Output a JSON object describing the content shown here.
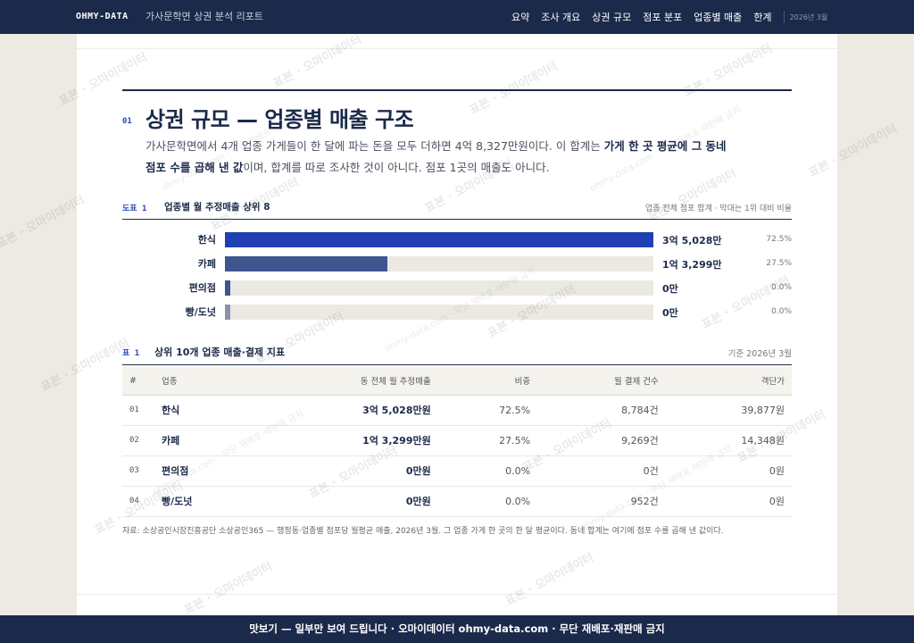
{
  "header": {
    "brand": "OHMY-DATA",
    "report_title": "가사문학면 상권 분석 리포트",
    "nav": [
      "요약",
      "조사 개요",
      "상권 규모",
      "점포 분포",
      "업종별 매출",
      "한계"
    ],
    "date": "2026년 3월"
  },
  "section": {
    "number": "01",
    "title": "상권 규모 — 업종별 매출 구조",
    "lead_part1": "가사문학면에서 4개 업종 가게들이 한 달에 파는 돈을 모두 더하면 4억 8,327만원이다. 이 합계는 ",
    "lead_bold": "가게 한 곳 평균에 그 동네 점포 수를 곱해 낸 값",
    "lead_part2": "이며, 합계를 따로 조사한 것이 아니다. 점포 1곳의 매출도 아니다."
  },
  "figure": {
    "tag": "도표 1",
    "title": "업종별 월 추정매출 상위 8",
    "note": "업종 전체 점포 합계 · 막대는 1위 대비 비율",
    "colors": [
      "#1f3fb3",
      "#3f5590",
      "#3f5590",
      "#8c93a8"
    ],
    "bars": [
      {
        "label": "한식",
        "amount": "3억 5,028만",
        "pct": "72.5%",
        "ratio": 1.0
      },
      {
        "label": "카페",
        "amount": "1억 3,299만",
        "pct": "27.5%",
        "ratio": 0.38
      },
      {
        "label": "편의점",
        "amount": "0만",
        "pct": "0.0%",
        "ratio": 0.012
      },
      {
        "label": "빵/도넛",
        "amount": "0만",
        "pct": "0.0%",
        "ratio": 0.012
      }
    ]
  },
  "table": {
    "tag": "표 1",
    "title": "상위 10개 업종 매출·결제 지표",
    "note": "기준 2026년 3월",
    "headers": [
      "#",
      "업종",
      "동 전체 월 추정매출",
      "비중",
      "월 결제 건수",
      "객단가"
    ],
    "rows": [
      [
        "01",
        "한식",
        "3억 5,028만원",
        "72.5%",
        "8,784건",
        "39,877원"
      ],
      [
        "02",
        "카페",
        "1억 3,299만원",
        "27.5%",
        "9,269건",
        "14,348원"
      ],
      [
        "03",
        "편의점",
        "0만원",
        "0.0%",
        "0건",
        "0원"
      ],
      [
        "04",
        "빵/도넛",
        "0만원",
        "0.0%",
        "952건",
        "0원"
      ]
    ]
  },
  "source": "자료: 소상공인시장진흥공단 소상공인365 — 행정동·업종별 점포당 월평균 매출, 2026년 3월. 그 업종 가게 한 곳의 한 달 평균이다. 동네 합계는 여기에 점포 수를 곱해 낸 값이다.",
  "footer": "맛보기 — 일부만 보여 드립니다 · 오마이데이터 ohmy-data.com · 무단 재배포·재판매 금지",
  "watermark": {
    "main": "표본 · 오마이데이터",
    "sub": "ohmy-data.com · 무단 재배포·재판매 금지"
  }
}
